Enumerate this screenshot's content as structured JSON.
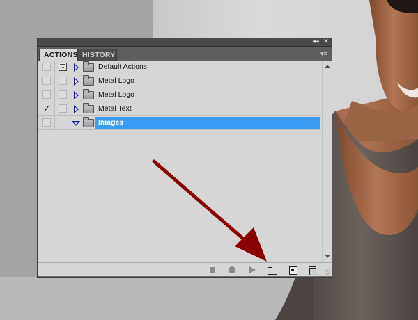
{
  "panel": {
    "collapse_glyph": "◂◂",
    "close_glyph": "✕",
    "menu_glyph": "▾≡"
  },
  "tabs": [
    {
      "label": "ACTIONS",
      "active": true
    },
    {
      "label": "HISTORY",
      "active": false
    }
  ],
  "actions": [
    {
      "label": "Default Actions",
      "checked": false,
      "dialog": true,
      "expanded": false,
      "selected": false
    },
    {
      "label": "Metal Logo",
      "checked": false,
      "dialog": false,
      "expanded": false,
      "selected": false
    },
    {
      "label": "Metal Logo",
      "checked": false,
      "dialog": false,
      "expanded": false,
      "selected": false
    },
    {
      "label": "Metal Text",
      "checked": true,
      "dialog": false,
      "expanded": false,
      "selected": false
    },
    {
      "label": "Images",
      "checked": false,
      "dialog": false,
      "expanded": true,
      "selected": true
    }
  ],
  "check_glyph": "✓",
  "colors": {
    "selection": "#3b9cf5",
    "arrow": "#8b0000",
    "expand_triangle": "#1a1a8c"
  },
  "bottom_icons": [
    "stop-icon",
    "record-icon",
    "play-icon",
    "new-set-icon",
    "new-action-icon",
    "trash-icon"
  ]
}
